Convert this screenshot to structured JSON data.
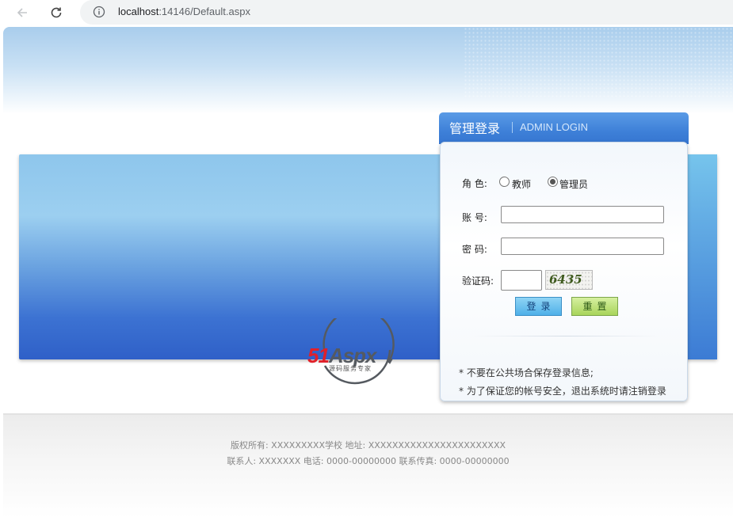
{
  "browser": {
    "url_host": "localhost",
    "url_path": ":14146/Default.aspx"
  },
  "logo": {
    "part1": "51",
    "part2": "Aspx",
    "subtitle": "源码服务专家"
  },
  "login": {
    "title_cn": "管理登录",
    "title_en": "ADMIN LOGIN",
    "role_label": "角 色:",
    "role_options": [
      "教师",
      "管理员"
    ],
    "role_selected": "管理员",
    "account_label": "账   号:",
    "account_value": "",
    "password_label": "密   码:",
    "password_value": "",
    "captcha_label": "验证码:",
    "captcha_value": "",
    "captcha_image_text": "6435",
    "login_button": "登录",
    "reset_button": "重置",
    "notes": [
      "* 不要在公共场合保存登录信息;",
      "* 为了保证您的帐号安全，退出系统时请注销登录"
    ]
  },
  "footer": {
    "line1": "版权所有: XXXXXXXXX学校 地址: XXXXXXXXXXXXXXXXXXXXXXX",
    "line2": "联系人: XXXXXXX 电话: 0000-00000000 联系传真: 0000-00000000"
  },
  "colors": {
    "header_blue": "#3e80d8",
    "login_button": "#4fb0e8",
    "reset_button": "#a8d45a"
  }
}
